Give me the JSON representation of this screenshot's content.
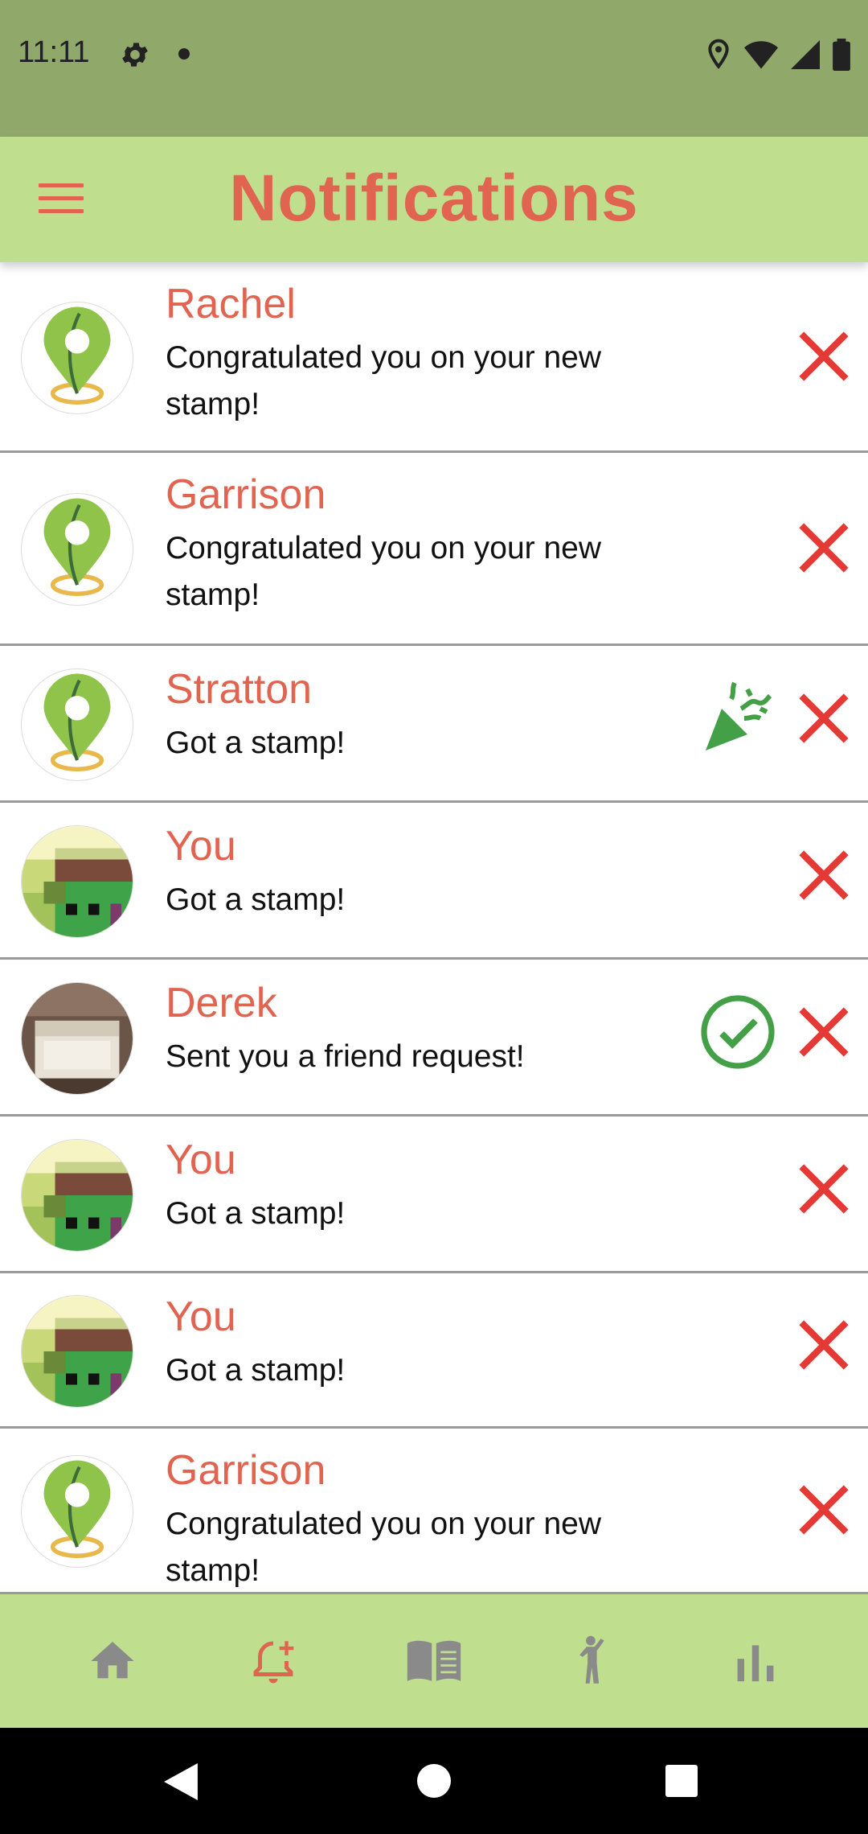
{
  "status_bar": {
    "time": "11:11"
  },
  "app_bar": {
    "title": "Notifications"
  },
  "notifications": [
    {
      "name": "Rachel",
      "message": "Congratulated you on your new stamp!",
      "avatar": "map-pin-icon",
      "action": null
    },
    {
      "name": "Garrison",
      "message": "Congratulated you on your new stamp!",
      "avatar": "map-pin-icon",
      "action": null
    },
    {
      "name": "Stratton",
      "message": "Got a stamp!",
      "avatar": "map-pin-icon",
      "action": "party-popper-icon"
    },
    {
      "name": "You",
      "message": "Got a stamp!",
      "avatar": "pixel-art-avatar",
      "action": null
    },
    {
      "name": "Derek",
      "message": "Sent you a friend request!",
      "avatar": "photo-avatar",
      "action": "check-circle-icon"
    },
    {
      "name": "You",
      "message": "Got a stamp!",
      "avatar": "pixel-art-avatar",
      "action": null
    },
    {
      "name": "You",
      "message": "Got a stamp!",
      "avatar": "pixel-art-avatar",
      "action": null
    },
    {
      "name": "Garrison",
      "message": "Congratulated you on your new stamp!",
      "avatar": "map-pin-icon",
      "action": null
    }
  ],
  "bottom_nav": {
    "items": [
      {
        "icon": "home-icon",
        "active": false
      },
      {
        "icon": "notification-add-icon",
        "active": true
      },
      {
        "icon": "book-icon",
        "active": false
      },
      {
        "icon": "person-waving-icon",
        "active": false
      },
      {
        "icon": "bar-chart-icon",
        "active": false
      }
    ]
  },
  "colors": {
    "accent": "#e06450",
    "app_bar": "#bfdf8f",
    "status_bar": "#91a86b",
    "close": "#e53935",
    "success": "#43a047",
    "nav_inactive": "#8a8a8a"
  }
}
